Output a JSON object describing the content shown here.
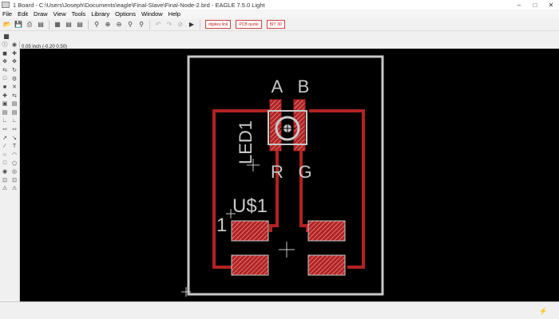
{
  "window": {
    "title": "1 Board - C:\\Users\\Joseph\\Documents\\eagle\\Final-Slave\\Final-Node-2.brd - EAGLE 7.5.0 Light",
    "controls": [
      "–",
      "□",
      "✕"
    ]
  },
  "menu": [
    "File",
    "Edit",
    "Draw",
    "View",
    "Tools",
    "Library",
    "Options",
    "Window",
    "Help"
  ],
  "toolbar": {
    "brand_buttons": [
      "digikey link",
      "PCB quote",
      "BIY 3D"
    ]
  },
  "coordinates": "0.05 inch (-0.20 0.50)",
  "board": {
    "labels": {
      "led_name": "LED1",
      "pin_a": "A",
      "pin_b": "B",
      "pin_r": "R",
      "pin_g": "G",
      "part_name": "U$1",
      "pin1_marker": "1"
    }
  },
  "colors": {
    "trace": "#b22222",
    "outline": "#c8c8c8",
    "canvas": "#000000"
  }
}
